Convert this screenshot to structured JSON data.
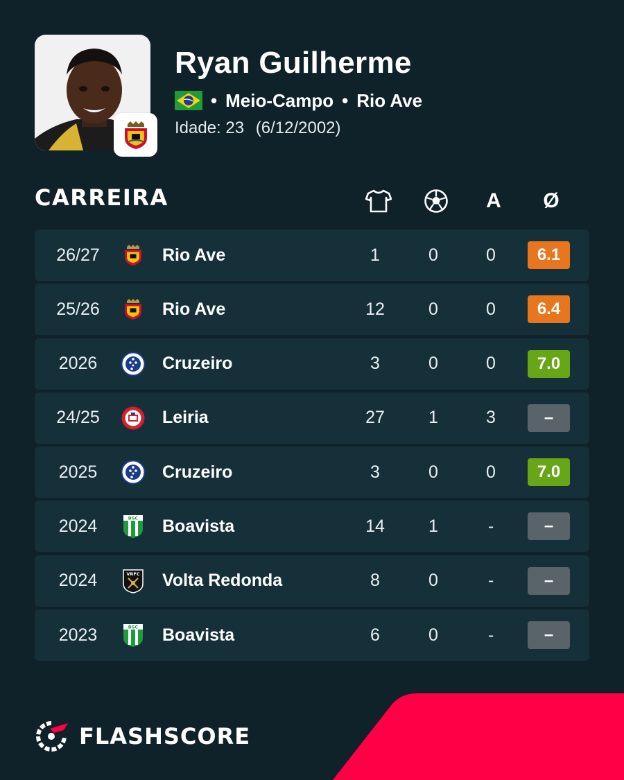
{
  "player": {
    "name": "Ryan Guilherme",
    "position": "Meio-Campo",
    "club": "Rio Ave",
    "age_label": "Idade: 23",
    "birth_date": "(6/12/2002)",
    "flag_icon": "brazil-flag-icon"
  },
  "career": {
    "title": "CARREIRA",
    "columns": {
      "apps_icon": "shirt-icon",
      "goals_icon": "football-icon",
      "assists_label": "A",
      "rating_label": "Ø"
    },
    "rows": [
      {
        "season": "26/27",
        "club": "Rio Ave",
        "apps": "1",
        "goals": "0",
        "assists": "0",
        "rating": "6.1",
        "rating_color": "#e8761e",
        "logo": "rio-ave-crest-icon"
      },
      {
        "season": "25/26",
        "club": "Rio Ave",
        "apps": "12",
        "goals": "0",
        "assists": "0",
        "rating": "6.4",
        "rating_color": "#e8761e",
        "logo": "rio-ave-crest-icon"
      },
      {
        "season": "2026",
        "club": "Cruzeiro",
        "apps": "3",
        "goals": "0",
        "assists": "0",
        "rating": "7.0",
        "rating_color": "#67a617",
        "logo": "cruzeiro-crest-icon"
      },
      {
        "season": "24/25",
        "club": "Leiria",
        "apps": "27",
        "goals": "1",
        "assists": "3",
        "rating": "–",
        "rating_color": "#5a6369",
        "logo": "leiria-crest-icon"
      },
      {
        "season": "2025",
        "club": "Cruzeiro",
        "apps": "3",
        "goals": "0",
        "assists": "0",
        "rating": "7.0",
        "rating_color": "#67a617",
        "logo": "cruzeiro-crest-icon"
      },
      {
        "season": "2024",
        "club": "Boavista",
        "apps": "14",
        "goals": "1",
        "assists": "-",
        "rating": "–",
        "rating_color": "#5a6369",
        "logo": "boavista-crest-icon"
      },
      {
        "season": "2024",
        "club": "Volta Redonda",
        "apps": "8",
        "goals": "0",
        "assists": "-",
        "rating": "–",
        "rating_color": "#5a6369",
        "logo": "volta-redonda-crest-icon"
      },
      {
        "season": "2023",
        "club": "Boavista",
        "apps": "6",
        "goals": "0",
        "assists": "-",
        "rating": "–",
        "rating_color": "#5a6369",
        "logo": "boavista-crest-icon"
      }
    ]
  },
  "brand": {
    "name": "FLASHSCORE",
    "accent": "#ff0046"
  },
  "colors": {
    "background": "#0f2129",
    "row_background": "#16303a"
  }
}
